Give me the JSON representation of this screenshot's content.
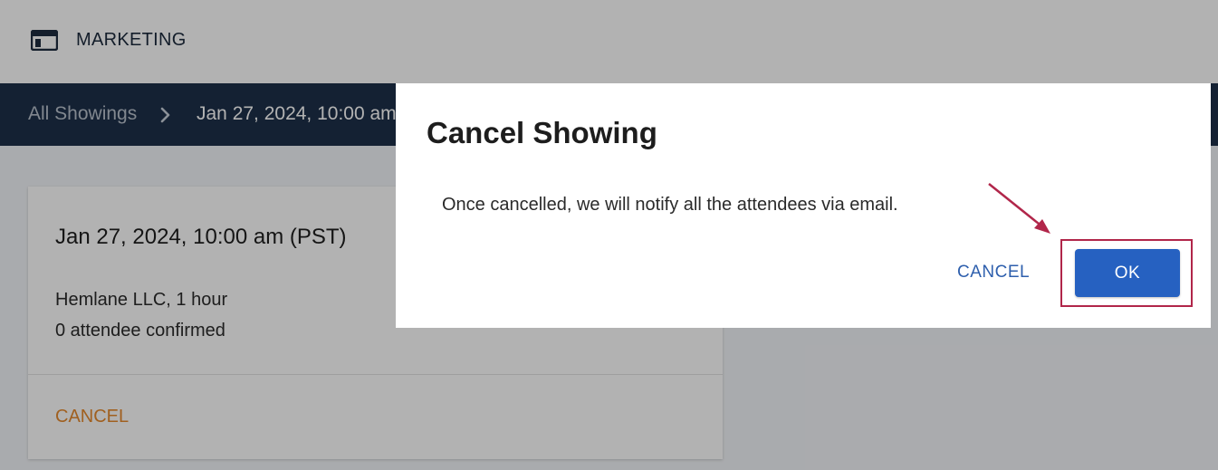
{
  "header": {
    "app_icon": "browser-window-icon",
    "title": "MARKETING"
  },
  "breadcrumb": {
    "root": "All Showings",
    "separator_icon": "chevron-right-icon",
    "current": "Jan 27, 2024, 10:00 am"
  },
  "showing_card": {
    "title": "Jan 27, 2024, 10:00 am (PST)",
    "organizer_duration": "Hemlane LLC, 1 hour",
    "attendees": "0 attendee confirmed",
    "cancel_label": "CANCEL"
  },
  "dialog": {
    "title": "Cancel Showing",
    "message": "Once cancelled, we will notify all the attendees via email.",
    "cancel_label": "CANCEL",
    "ok_label": "OK"
  },
  "colors": {
    "brand_dark": "#1d3049",
    "primary": "#2661c1",
    "warning": "#e58a2e",
    "annotation": "#b1264a"
  }
}
